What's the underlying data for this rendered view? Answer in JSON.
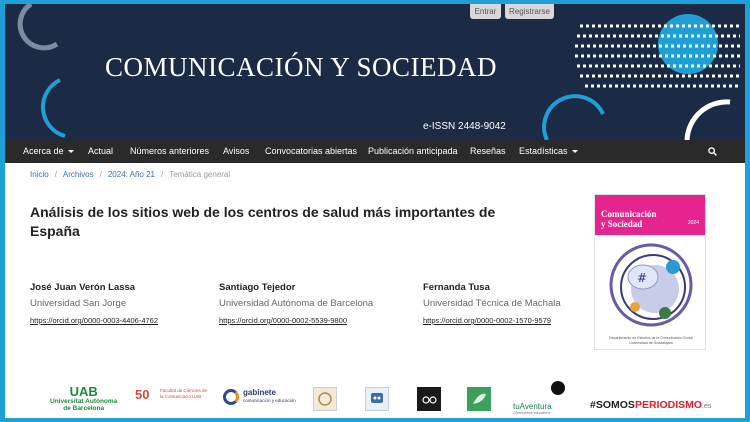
{
  "header": {
    "journal_title": "COMUNICACIÓN Y SOCIEDAD",
    "issn": "e-ISSN 2448-9042",
    "login_label": "Entrar",
    "register_label": "Registrarse"
  },
  "nav": {
    "items": [
      {
        "label": "Acerca de",
        "has_dropdown": true
      },
      {
        "label": "Actual"
      },
      {
        "label": "Números anteriores"
      },
      {
        "label": "Avisos"
      },
      {
        "label": "Convocatorias abiertas"
      },
      {
        "label": "Publicación anticipada"
      },
      {
        "label": "Reseñas"
      },
      {
        "label": "Estadísticas",
        "has_dropdown": true
      }
    ],
    "search_label": "Buscar"
  },
  "breadcrumb": {
    "items": [
      "Inicio",
      "Archivos",
      "2024: Año 21",
      "Temática general"
    ],
    "separator": "/"
  },
  "article": {
    "title": "Análisis de los sitios web de los centros de salud más importantes de España",
    "authors": [
      {
        "name": "José Juan Verón Lassa",
        "affiliation": "Universidad San Jorge",
        "orcid": "https://orcid.org/0000-0003-4406-4762"
      },
      {
        "name": "Santiago Tejedor",
        "affiliation": "Universidad Autónoma de Barcelona",
        "orcid": "https://orcid.org/0000-0002-5539-9800"
      },
      {
        "name": "Fernanda Tusa",
        "affiliation": "Universidad Técnica de Machala",
        "orcid": "https://orcid.org/0000-0002-1570-9579"
      }
    ]
  },
  "cover": {
    "title_line1": "Comunicación",
    "title_line2": "y Sociedad",
    "year": "2024",
    "footer_line1": "Departamento de Estudios de la Comunicación Social",
    "footer_line2": "Universidad de Guadalajara"
  },
  "footer_logos": {
    "uab_big": "UAB",
    "uab_line1": "Universitat Autònoma",
    "uab_line2": "de Barcelona",
    "faculty_number": "50",
    "faculty_text": "Facultat de Ciències de la Comunicació UAB",
    "gabinete_name": "gabinete",
    "gabinete_sub": "comunicación y educación",
    "tv_name": "tuAventura",
    "tv_sub": "Cibermedios educativos",
    "somos_prefix": "#SOMOS",
    "somos_highlight": "PERIODISMO",
    "somos_suffix": ".es"
  },
  "colors": {
    "header_bg": "#1b2b45",
    "accent_blue": "#1f9fd6",
    "nav_bg": "#2a2a2a",
    "link": "#3a6ea8",
    "cover_pink": "#e6248e"
  }
}
